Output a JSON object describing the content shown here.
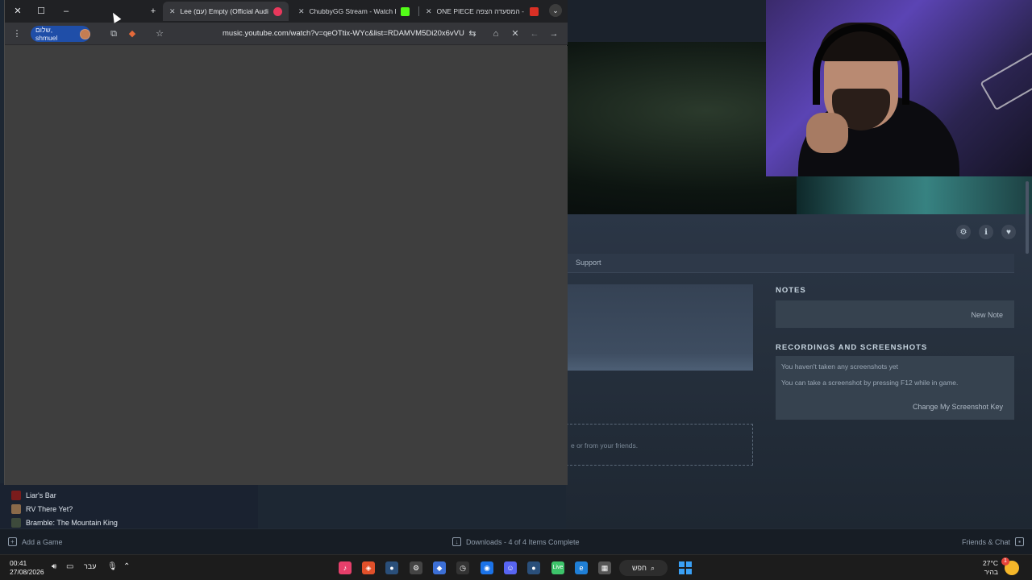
{
  "chrome": {
    "tabs": [
      {
        "label": "Lee (עם) Empty (Official Audio)",
        "active": true,
        "favicon_color": "#e8385c"
      },
      {
        "label": "ChubbyGG Stream - Watch Live",
        "active": false,
        "favicon_color": "#53fc18"
      },
      {
        "label": "ONE PIECE לגו - המסעדה הצפה",
        "active": false,
        "favicon_color": "#d93025"
      }
    ],
    "profile_name": "שלום, shmuel",
    "url": "music.youtube.com/watch?v=qeOTtix-WYc&list=RDAMVM5Di20x6vVU"
  },
  "steam": {
    "tab_support": "Support",
    "notes_title": "NOTES",
    "new_note": "New Note",
    "recordings_title": "RECORDINGS AND SCREENSHOTS",
    "no_shots": "You haven't taken any screenshots yet",
    "shot_hint": "You can take a screenshot by pressing F12 while in game.",
    "change_key": "Change My Screenshot Key",
    "friends_text": "e or from your friends.",
    "games": [
      {
        "name": "Liar's Bar",
        "color": "#7a1c1c"
      },
      {
        "name": "RV There Yet?",
        "color": "#8a6a4a"
      },
      {
        "name": "Bramble: The Mountain King",
        "color": "#3d4a3b"
      }
    ],
    "footer": {
      "add_game": "Add a Game",
      "downloads": "Downloads - 4 of 4 Items Complete",
      "friends_chat": "Friends & Chat"
    }
  },
  "taskbar": {
    "time": "00:41",
    "date": "27/08/2026",
    "language": "עבר",
    "search": "חפש",
    "weather_temp": "27°C",
    "weather_desc": "בהיר",
    "notification_count": "1",
    "pinned_icons": [
      "tiktok-icon",
      "brave-icon",
      "steam-icon",
      "steelseries-icon",
      "app-icon",
      "clock-app-icon",
      "chrome-icon",
      "discord-icon",
      "steam-alt-icon",
      "live-icon",
      "edge-icon",
      "calculator-icon"
    ]
  }
}
